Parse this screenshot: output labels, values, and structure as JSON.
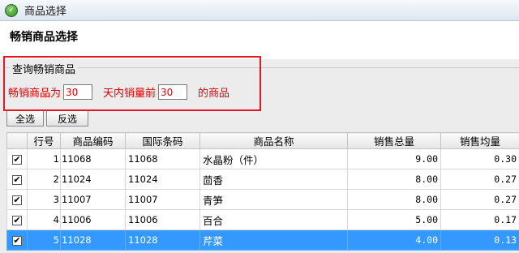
{
  "window": {
    "title": "商品选择",
    "icon": "app-leaf-icon"
  },
  "header": {
    "title": "畅销商品选择"
  },
  "query": {
    "legend": "查询畅销商品",
    "prefix": "畅销商品为",
    "days_value": "30",
    "middle": "天内销量前",
    "top_value": "30",
    "suffix": "的商品"
  },
  "buttons": {
    "select_all": "全选",
    "invert": "反选"
  },
  "table": {
    "columns": [
      "",
      "行号",
      "商品编码",
      "国际条码",
      "商品名称",
      "销售总量",
      "销售均量"
    ],
    "rows": [
      {
        "checked": "✔",
        "row_no": "1",
        "code": "11068",
        "barcode": "11068",
        "name": "水晶粉（件）",
        "total": "9.00",
        "avg": "0.30"
      },
      {
        "checked": "✔",
        "row_no": "2",
        "code": "11024",
        "barcode": "11024",
        "name": "茴香",
        "total": "8.00",
        "avg": "0.27"
      },
      {
        "checked": "✔",
        "row_no": "3",
        "code": "11007",
        "barcode": "11007",
        "name": "青笋",
        "total": "8.00",
        "avg": "0.27"
      },
      {
        "checked": "✔",
        "row_no": "4",
        "code": "11006",
        "barcode": "11006",
        "name": "百合",
        "total": "5.00",
        "avg": "0.17"
      },
      {
        "checked": "✔",
        "row_no": "5",
        "code": "11028",
        "barcode": "11028",
        "name": "芹菜",
        "total": "4.00",
        "avg": "0.13"
      }
    ]
  },
  "colors": {
    "query_text": "#e00000",
    "highlight_border": "#e8161f",
    "selected_row": "#3399ff"
  }
}
